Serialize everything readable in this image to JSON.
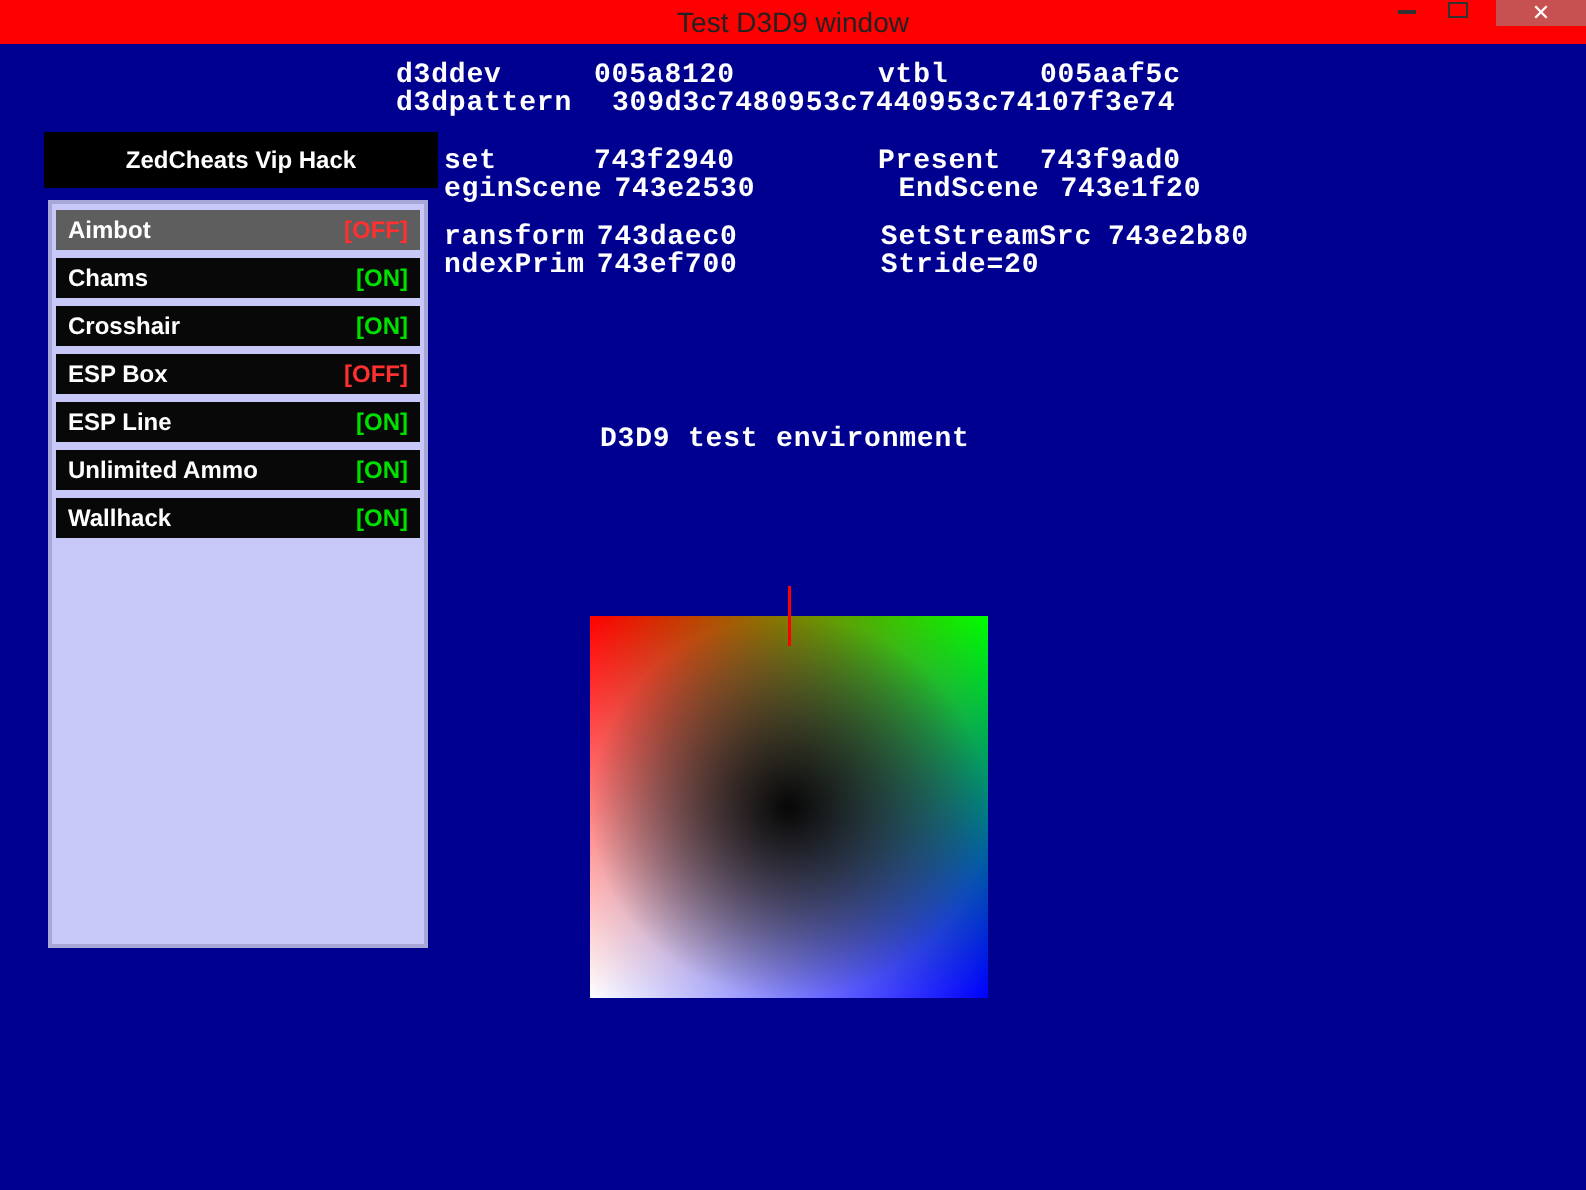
{
  "window": {
    "title": "Test D3D9 window",
    "close_glyph": "✕"
  },
  "debug_groups": [
    {
      "kind": "full",
      "rows": [
        [
          "d3ddev",
          "005a8120",
          "vtbl",
          "005aaf5c"
        ],
        [
          "d3dpattern",
          "309d3c7480953c7440953c74107f3e74"
        ]
      ]
    },
    {
      "kind": "cut",
      "rows": [
        [
          "set",
          "743f2940",
          "Present",
          "743f9ad0"
        ],
        [
          "eginScene",
          "743e2530",
          "EndScene",
          "743e1f20"
        ]
      ]
    },
    {
      "kind": "cut",
      "rows": [
        [
          "ransform",
          "743daec0",
          "SetStreamSrc",
          "743e2b80"
        ],
        [
          "ndexPrim",
          "743ef700",
          "Stride=20"
        ]
      ]
    }
  ],
  "caption": "D3D9 test environment",
  "menu": {
    "title": "ZedCheats Vip Hack",
    "items": [
      {
        "label": "Aimbot",
        "status": "[OFF]",
        "on": false,
        "selected": true
      },
      {
        "label": "Chams",
        "status": "[ON]",
        "on": true,
        "selected": false
      },
      {
        "label": "Crosshair",
        "status": "[ON]",
        "on": true,
        "selected": false
      },
      {
        "label": "ESP Box",
        "status": "[OFF]",
        "on": false,
        "selected": false
      },
      {
        "label": "ESP Line",
        "status": "[ON]",
        "on": true,
        "selected": false
      },
      {
        "label": "Unlimited Ammo",
        "status": "[ON]",
        "on": true,
        "selected": false
      },
      {
        "label": "Wallhack",
        "status": "[ON]",
        "on": true,
        "selected": false
      }
    ]
  }
}
